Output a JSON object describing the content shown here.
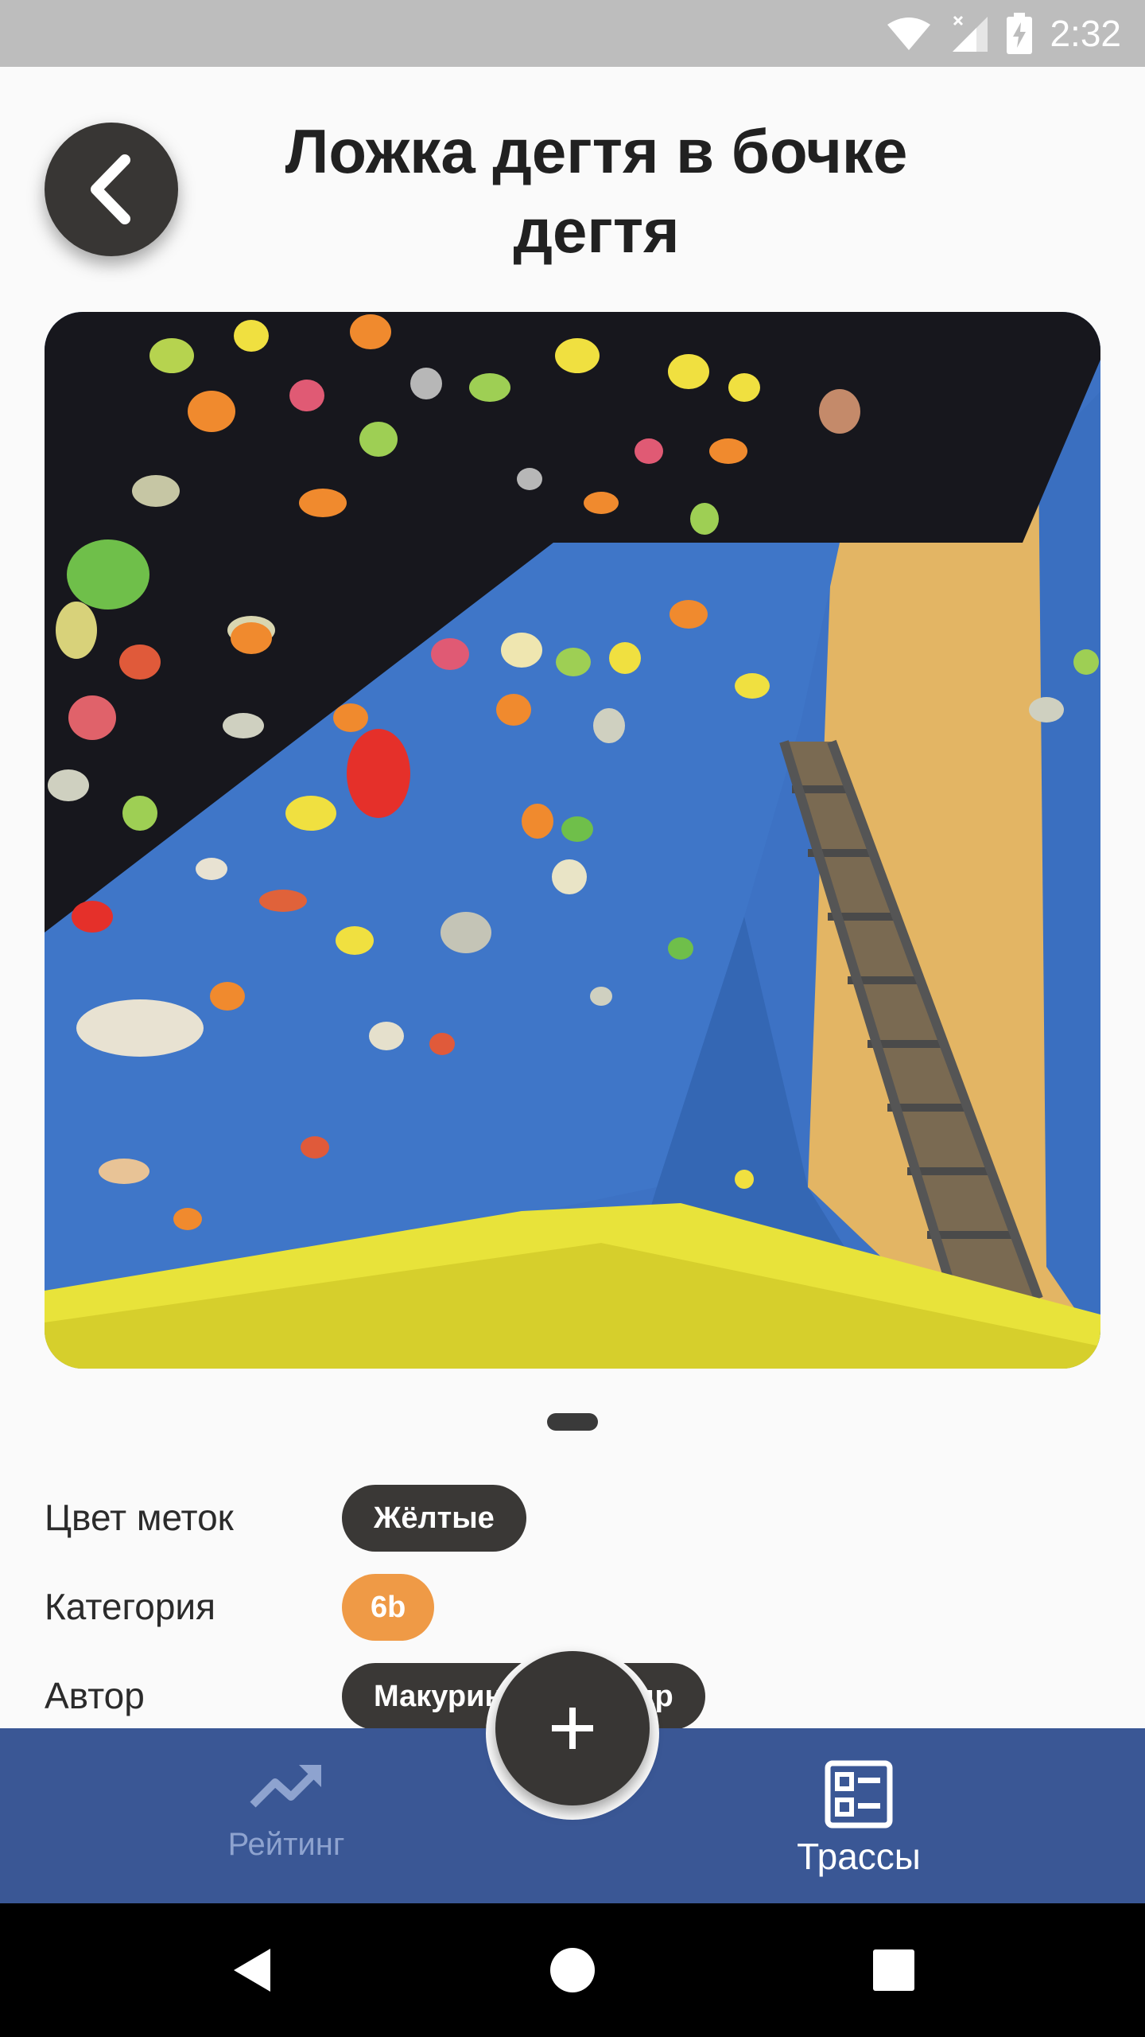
{
  "status_bar": {
    "time": "2:32",
    "icons": [
      "wifi-icon",
      "signal-icon",
      "battery-charging-icon"
    ]
  },
  "header": {
    "back_icon": "chevron-left-icon",
    "title": "Ложка дегтя в бочке дегтя"
  },
  "photo": {
    "page_count": 1,
    "current_page": 1
  },
  "details": {
    "marker_color": {
      "label": "Цвет меток",
      "value": "Жёлтые"
    },
    "category": {
      "label": "Категория",
      "value": "6b"
    },
    "author": {
      "label": "Автор",
      "value": "Макурин Александр"
    }
  },
  "bottom_nav": {
    "items": [
      {
        "label": "Рейтинг",
        "icon": "trending-up-icon",
        "active": false
      },
      {
        "label": "Трассы",
        "icon": "list-view-icon",
        "active": true
      }
    ],
    "fab_icon": "plus-icon"
  },
  "system_nav": {
    "buttons": [
      "back-triangle-icon",
      "home-circle-icon",
      "recents-square-icon"
    ]
  },
  "colors": {
    "nav_background": "#3a5795",
    "dark_chip": "#3a3836",
    "category_chip": "#ef9a46",
    "status_bar": "#bdbdbd"
  }
}
